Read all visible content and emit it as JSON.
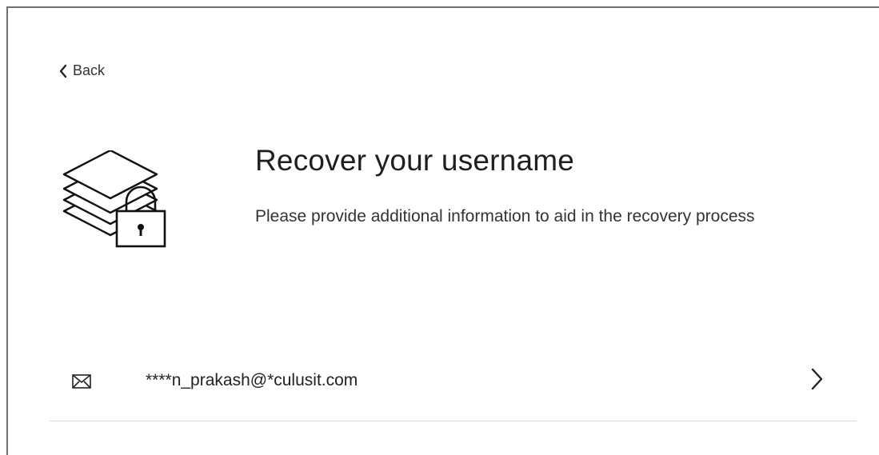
{
  "nav": {
    "back_label": "Back"
  },
  "header": {
    "title": "Recover your username",
    "subtitle": "Please provide additional information to aid in the recovery process"
  },
  "options": [
    {
      "icon": "mail-icon",
      "label": "****n_prakash@*culusit.com"
    }
  ],
  "icons": {
    "back": "chevron-left-icon",
    "hero": "stacked-documents-lock-icon",
    "option": "chevron-right-icon"
  },
  "colors": {
    "text": "#222222",
    "divider": "#d9d9d9",
    "frame_border": "#6f6f6f"
  }
}
